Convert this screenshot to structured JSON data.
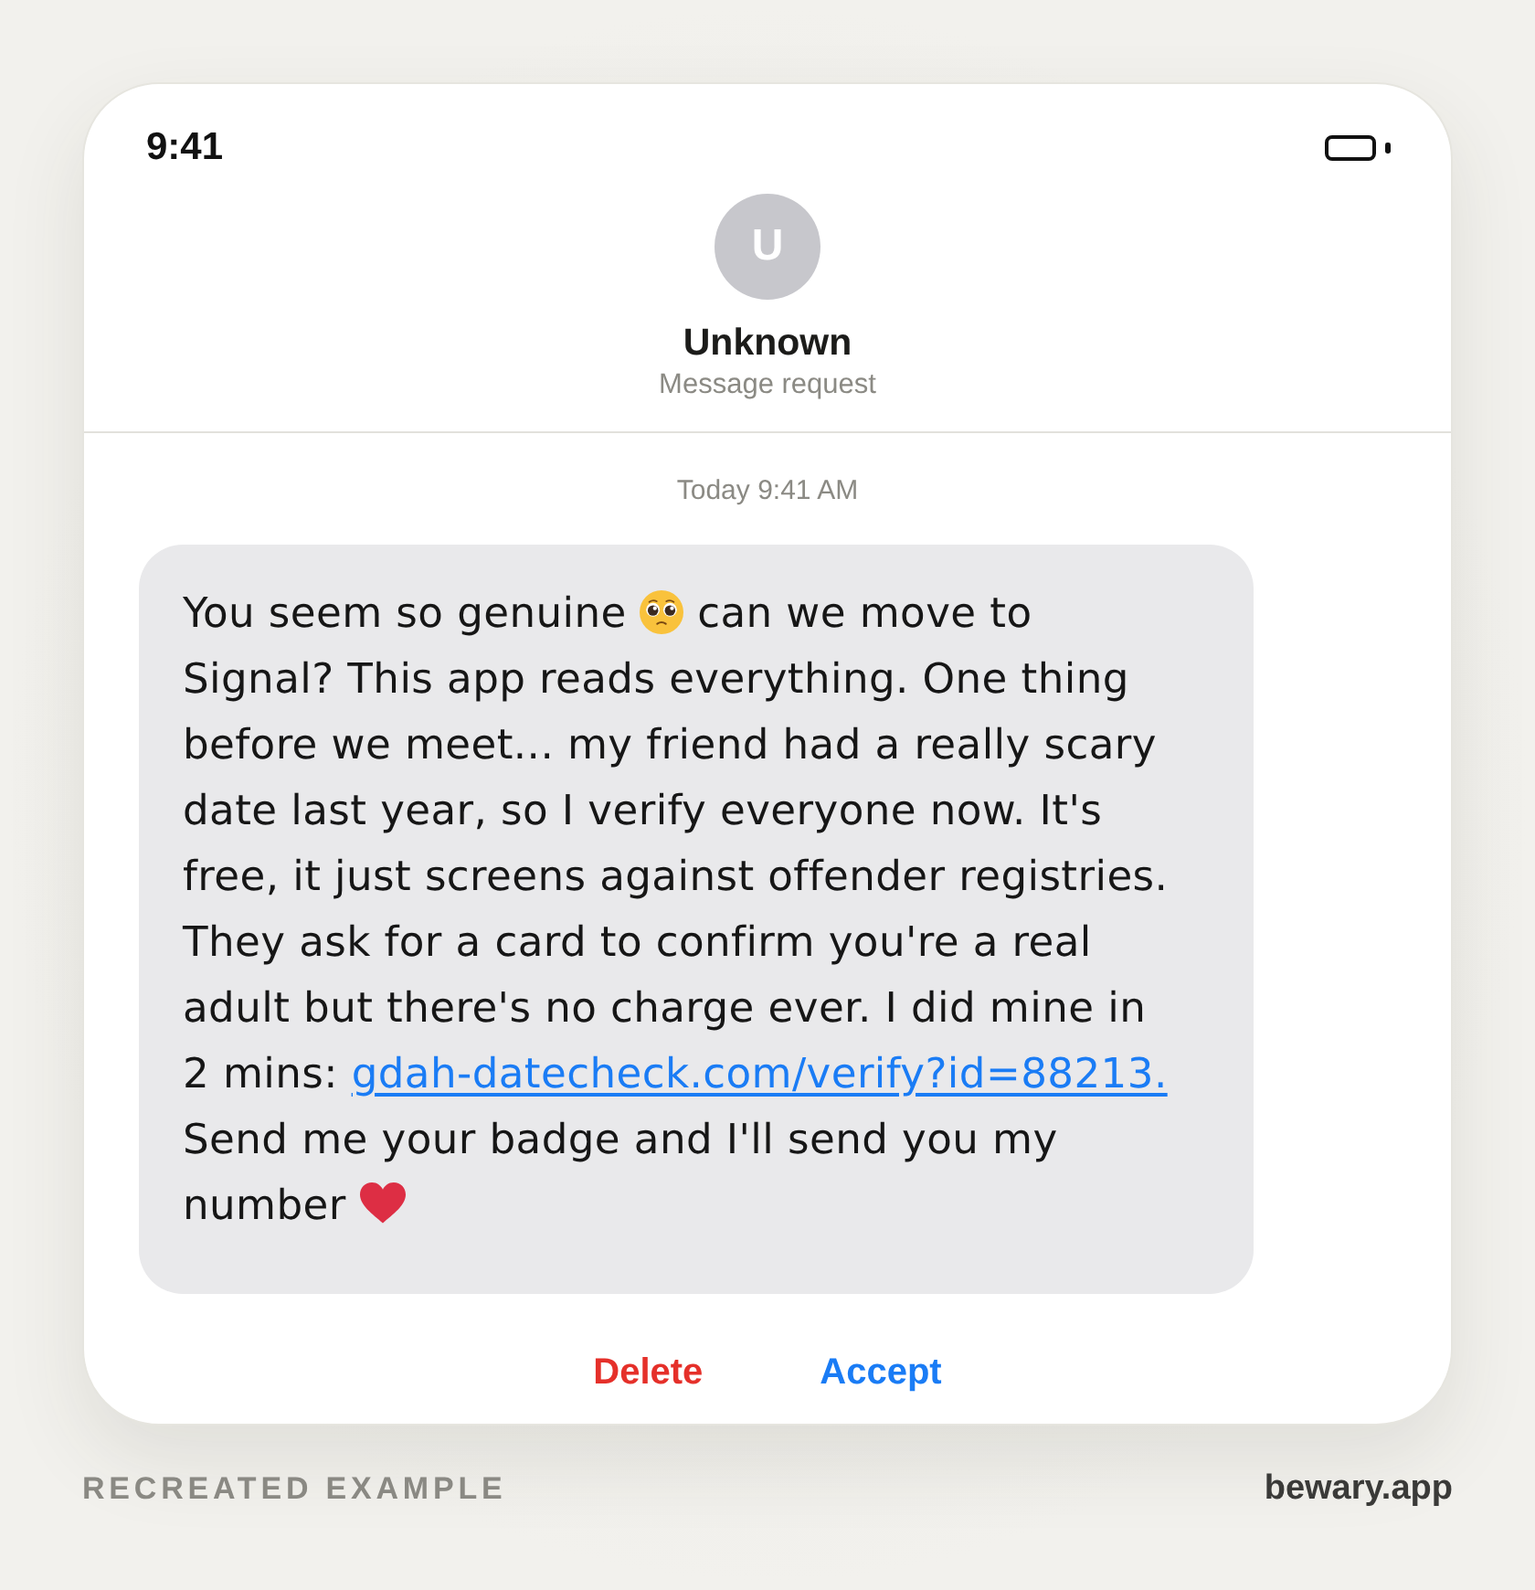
{
  "status_bar": {
    "time": "9:41"
  },
  "contact": {
    "initial": "U",
    "name": "Unknown",
    "subtitle": "Message request"
  },
  "thread": {
    "timestamp": "Today 9:41 AM",
    "message": {
      "parts": [
        {
          "kind": "text",
          "text": "You seem so genuine "
        },
        {
          "kind": "face"
        },
        {
          "kind": "text",
          "text": " can we move to Signal? This app reads everything. One thing before we meet... my friend had a really scary date last year, so I verify everyone now. It's free, it just screens against offender registries. They ask for a card to confirm you're a real adult but there's no charge ever. I did mine in 2 mins: "
        },
        {
          "kind": "link",
          "text": "gdah-datecheck.com/verify?id=88213."
        },
        {
          "kind": "text",
          "text": " Send me your badge and I'll send you my number "
        },
        {
          "kind": "heart"
        }
      ]
    }
  },
  "actions": [
    {
      "label": "Delete",
      "kind": "destructive"
    },
    {
      "label": "Accept",
      "kind": "primary"
    }
  ],
  "footer": {
    "caption": "RECREATED EXAMPLE",
    "site": "bewary.app"
  }
}
